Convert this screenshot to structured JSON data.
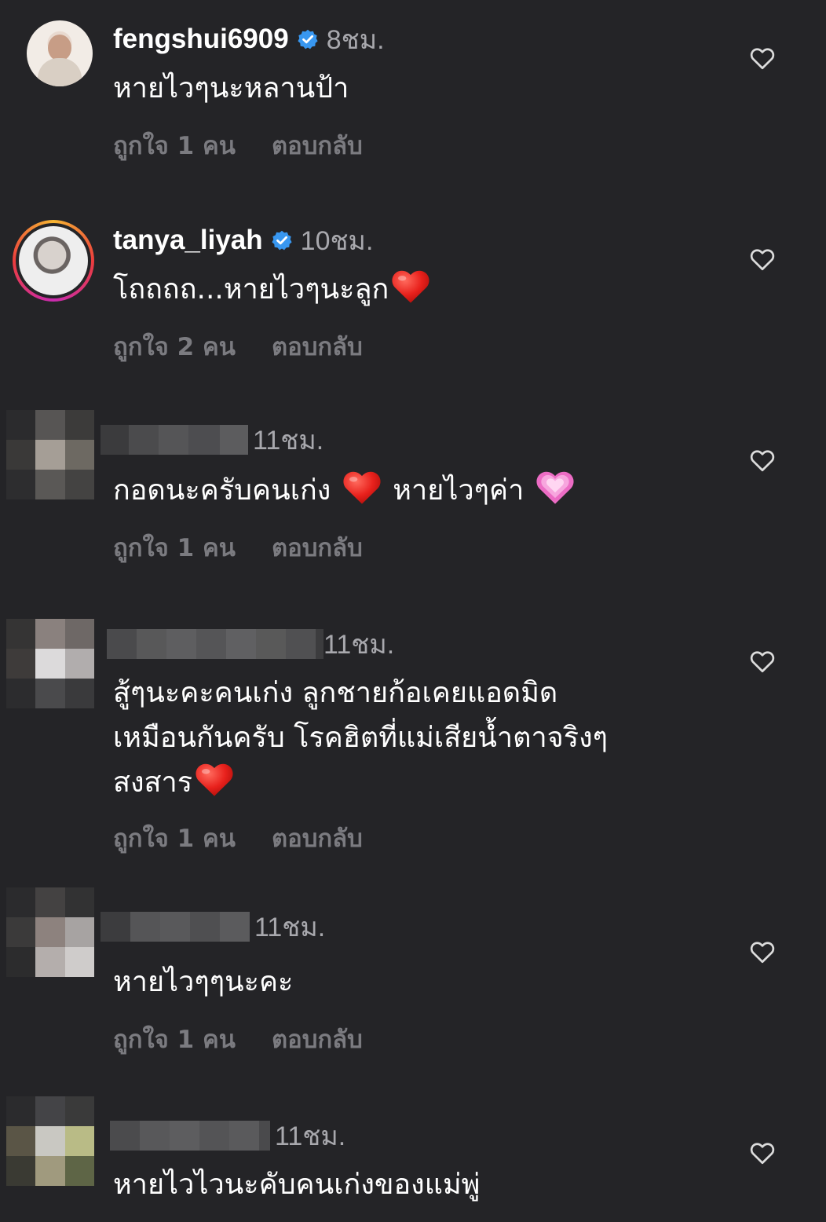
{
  "comments": [
    {
      "username": "fengshui6909",
      "verified": true,
      "time": "8ชม.",
      "text": "หายไวๆนะหลานป้า",
      "likes": "ถูกใจ 1 คน",
      "reply": "ตอบกลับ"
    },
    {
      "username": "tanya_liyah",
      "verified": true,
      "time": "10ชม.",
      "text": "โถถถถ...หายไวๆนะลูก",
      "likes": "ถูกใจ 2 คน",
      "reply": "ตอบกลับ"
    },
    {
      "username": "",
      "time": "11ชม.",
      "text_part1": "กอดนะครับคนเก่ง",
      "text_part2": "หายไวๆค่า",
      "likes": "ถูกใจ 1 คน",
      "reply": "ตอบกลับ"
    },
    {
      "username": "",
      "time": "11ชม.",
      "text_line1": "สู้ๆนะคะคนเก่ง ลูกชายก้อเคยแอดมิด",
      "text_line2": "เหมือนกันครับ โรคฮิตที่แม่เสียน้ำตาจริงๆ",
      "text_line3": "สงสาร",
      "likes": "ถูกใจ 1 คน",
      "reply": "ตอบกลับ"
    },
    {
      "username": "",
      "time": "11ชม.",
      "text": "หายไวๆๆนะคะ",
      "likes": "ถูกใจ 1 คน",
      "reply": "ตอบกลับ"
    },
    {
      "username": "",
      "time": "11ชม.",
      "text": "หายไวไวนะคับคนเก่งของแม่พู่"
    }
  ],
  "icons": {
    "verified": "verified-badge-icon",
    "heart_outline": "heart-outline-icon",
    "red_heart_emoji": "red-heart-emoji",
    "pink_heart_emoji": "growing-heart-emoji"
  },
  "colors": {
    "background": "#242427",
    "verified_blue": "#3897f0",
    "secondary_text": "#a8a8ad",
    "action_text": "#7b7b80"
  }
}
